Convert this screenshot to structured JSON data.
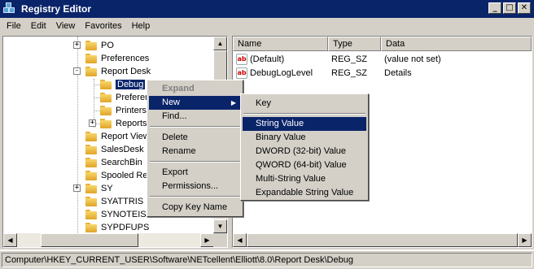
{
  "window": {
    "title": "Registry Editor"
  },
  "menubar": [
    "File",
    "Edit",
    "View",
    "Favorites",
    "Help"
  ],
  "tree": {
    "items": [
      {
        "label": "PO",
        "expander": "+"
      },
      {
        "label": "Preferences",
        "expander": ""
      },
      {
        "label": "Report Desk",
        "expander": "-"
      },
      {
        "label": "Debug",
        "expander": "",
        "selected": true
      },
      {
        "label": "Preferences",
        "expander": ""
      },
      {
        "label": "Printers",
        "expander": ""
      },
      {
        "label": "Reports",
        "expander": "+"
      },
      {
        "label": "Report Viewer",
        "expander": ""
      },
      {
        "label": "SalesDesk",
        "expander": ""
      },
      {
        "label": "SearchBin",
        "expander": ""
      },
      {
        "label": "Spooled Reports",
        "expander": ""
      },
      {
        "label": "SY",
        "expander": "+"
      },
      {
        "label": "SYATTRIS",
        "expander": ""
      },
      {
        "label": "SYNOTEIS",
        "expander": ""
      },
      {
        "label": "SYPDFUPS",
        "expander": ""
      }
    ]
  },
  "list": {
    "columns": [
      "Name",
      "Type",
      "Data"
    ],
    "rows": [
      {
        "name": "(Default)",
        "type": "REG_SZ",
        "data": "(value not set)",
        "icon": "string-value-icon"
      },
      {
        "name": "DebugLogLevel",
        "type": "REG_SZ",
        "data": "Details",
        "icon": "string-value-icon"
      }
    ]
  },
  "context_menu": {
    "items": [
      "Expand",
      "New",
      "Find...",
      "Delete",
      "Rename",
      "Export",
      "Permissions...",
      "Copy Key Name"
    ]
  },
  "submenu": {
    "items": [
      "Key",
      "String Value",
      "Binary Value",
      "DWORD (32-bit) Value",
      "QWORD (64-bit) Value",
      "Multi-String Value",
      "Expandable String Value"
    ],
    "highlighted": "String Value"
  },
  "status": {
    "path": "Computer\\HKEY_CURRENT_USER\\Software\\NETcellent\\Elliott\\8.0\\Report Desk\\Debug"
  },
  "colors": {
    "selection": "#0a246a",
    "chrome": "#d4d0c8"
  }
}
